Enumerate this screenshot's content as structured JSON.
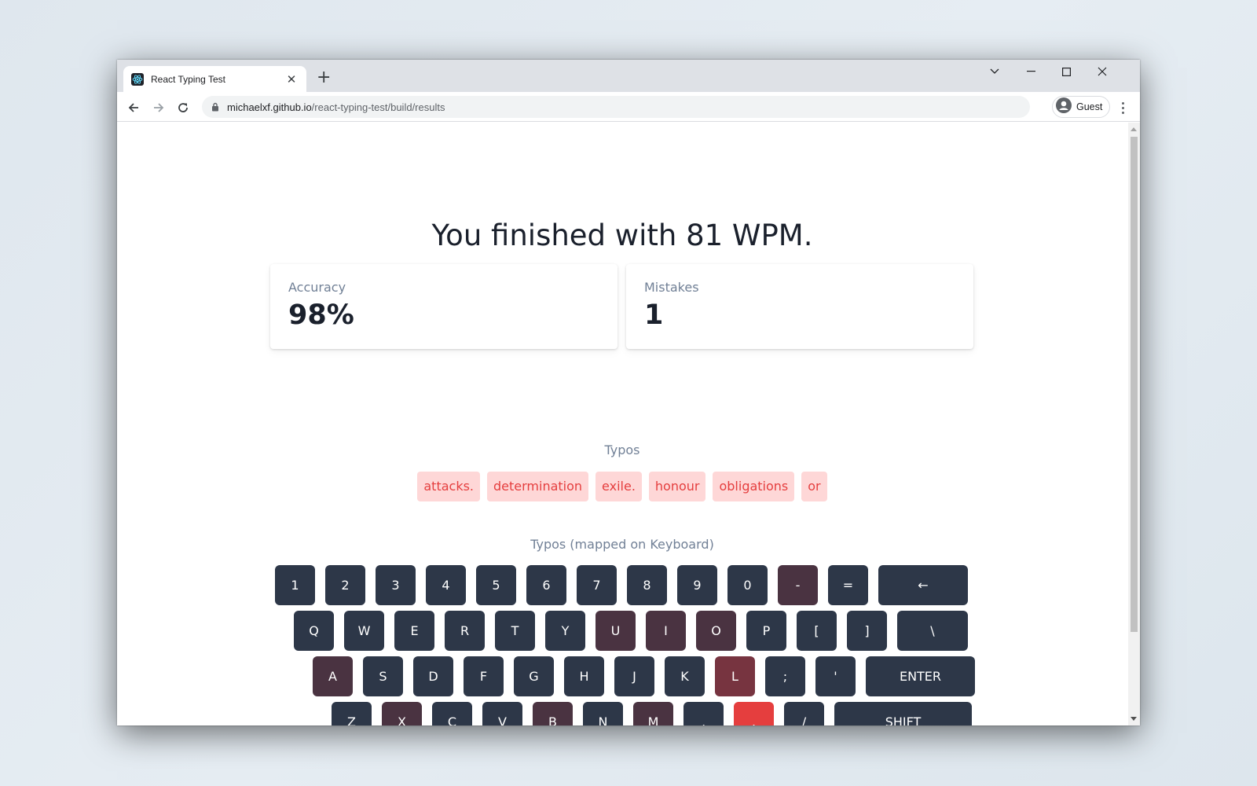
{
  "browser": {
    "tab_title": "React Typing Test",
    "url_host": "michaelxf.github.io",
    "url_path": "/react-typing-test/build/results",
    "profile_label": "Guest"
  },
  "results": {
    "headline": "You finished with 81 WPM.",
    "accuracy_label": "Accuracy",
    "accuracy_value": "98%",
    "mistakes_label": "Mistakes",
    "mistakes_value": "1",
    "typos_label": "Typos",
    "typos": [
      "attacks.",
      "determination",
      "exile.",
      "honour",
      "obligations",
      "or"
    ],
    "keyboard_label": "Typos (mapped on Keyboard)"
  },
  "colors": {
    "key_default": "#2d3748",
    "key_light": "#4a3341",
    "key_medium": "#773440",
    "key_heavy": "#e53e3e"
  },
  "keyboard": {
    "rows": [
      [
        {
          "label": "1",
          "heat": 0
        },
        {
          "label": "2",
          "heat": 0
        },
        {
          "label": "3",
          "heat": 0
        },
        {
          "label": "4",
          "heat": 0
        },
        {
          "label": "5",
          "heat": 0
        },
        {
          "label": "6",
          "heat": 0
        },
        {
          "label": "7",
          "heat": 0
        },
        {
          "label": "8",
          "heat": 0
        },
        {
          "label": "9",
          "heat": 0
        },
        {
          "label": "0",
          "heat": 0
        },
        {
          "label": "-",
          "heat": 1
        },
        {
          "label": "=",
          "heat": 0
        },
        {
          "label": "←",
          "heat": 0,
          "wide": "backspace"
        }
      ],
      [
        {
          "label": "Q",
          "heat": 0
        },
        {
          "label": "W",
          "heat": 0
        },
        {
          "label": "E",
          "heat": 0
        },
        {
          "label": "R",
          "heat": 0
        },
        {
          "label": "T",
          "heat": 0
        },
        {
          "label": "Y",
          "heat": 0
        },
        {
          "label": "U",
          "heat": 1
        },
        {
          "label": "I",
          "heat": 1
        },
        {
          "label": "O",
          "heat": 1
        },
        {
          "label": "P",
          "heat": 0
        },
        {
          "label": "[",
          "heat": 0
        },
        {
          "label": "]",
          "heat": 0
        },
        {
          "label": "\\",
          "heat": 0,
          "wide": "backslash"
        }
      ],
      [
        {
          "label": "A",
          "heat": 1
        },
        {
          "label": "S",
          "heat": 0
        },
        {
          "label": "D",
          "heat": 0
        },
        {
          "label": "F",
          "heat": 0
        },
        {
          "label": "G",
          "heat": 0
        },
        {
          "label": "H",
          "heat": 0
        },
        {
          "label": "J",
          "heat": 0
        },
        {
          "label": "K",
          "heat": 0
        },
        {
          "label": "L",
          "heat": 2
        },
        {
          "label": ";",
          "heat": 0
        },
        {
          "label": "'",
          "heat": 0
        },
        {
          "label": "ENTER",
          "heat": 0,
          "wide": "enter"
        }
      ],
      [
        {
          "label": "Z",
          "heat": 0
        },
        {
          "label": "X",
          "heat": 1
        },
        {
          "label": "C",
          "heat": 0
        },
        {
          "label": "V",
          "heat": 0
        },
        {
          "label": "B",
          "heat": 1
        },
        {
          "label": "N",
          "heat": 0
        },
        {
          "label": "M",
          "heat": 1
        },
        {
          "label": ",",
          "heat": 0
        },
        {
          "label": ".",
          "heat": 3
        },
        {
          "label": "/",
          "heat": 0
        },
        {
          "label": "SHIFT",
          "heat": 0,
          "wide": "shift"
        }
      ]
    ]
  }
}
